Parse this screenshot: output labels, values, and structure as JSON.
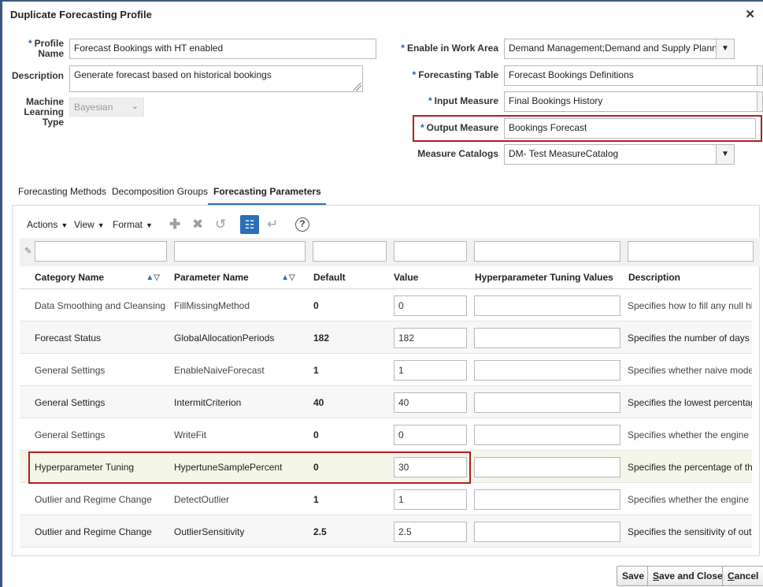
{
  "dialog": {
    "title": "Duplicate Forecasting Profile",
    "close_glyph": "✕"
  },
  "form": {
    "profile_name_label": "Profile Name",
    "profile_name_label_l1": "Profile",
    "profile_name_label_l2": "Name",
    "profile_name_value": "Forecast Bookings with HT enabled",
    "description_label": "Description",
    "description_value": "Generate forecast based on historical bookings",
    "ml_type_label_l1": "Machine",
    "ml_type_label_l2": "Learning",
    "ml_type_label_l3": "Type",
    "ml_type_value": "Bayesian",
    "work_area_label": "Enable in Work Area",
    "work_area_value": "Demand Management;Demand and Supply Planning",
    "forecasting_table_label": "Forecasting Table",
    "forecasting_table_value": "Forecast Bookings Definitions",
    "input_measure_label": "Input Measure",
    "input_measure_value": "Final Bookings History",
    "output_measure_label": "Output Measure",
    "output_measure_value": "Bookings Forecast",
    "measure_catalogs_label": "Measure Catalogs",
    "measure_catalogs_value": "DM- Test MeasureCatalog"
  },
  "tabs": [
    {
      "label": "Forecasting Methods",
      "active": false
    },
    {
      "label": "Decomposition Groups",
      "active": false
    },
    {
      "label": "Forecasting Parameters",
      "active": true
    }
  ],
  "toolbar": {
    "actions": "Actions",
    "view": "View",
    "format": "Format"
  },
  "table": {
    "headers": [
      "Category Name",
      "Parameter Name",
      "Default",
      "Value",
      "Hyperparameter Tuning Values",
      "Description"
    ],
    "rows": [
      {
        "category": "Data Smoothing and Cleansing",
        "parameter": "FillMissingMethod",
        "default": "0",
        "value": "0",
        "hyper": "",
        "description": "Specifies how to fill any null histo"
      },
      {
        "category": "Forecast Status",
        "parameter": "GlobalAllocationPeriods",
        "default": "182",
        "value": "182",
        "hyper": "",
        "description": "Specifies the number of days to"
      },
      {
        "category": "General Settings",
        "parameter": "EnableNaiveForecast",
        "default": "1",
        "value": "1",
        "hyper": "",
        "description": "Specifies whether naive modelin"
      },
      {
        "category": "General Settings",
        "parameter": "IntermitCriterion",
        "default": "40",
        "value": "40",
        "hyper": "",
        "description": "Specifies the lowest percentage"
      },
      {
        "category": "General Settings",
        "parameter": "WriteFit",
        "default": "0",
        "value": "0",
        "hyper": "",
        "description": "Specifies whether the engine on"
      },
      {
        "category": "Hyperparameter Tuning",
        "parameter": "HypertuneSamplePercent",
        "default": "0",
        "value": "30",
        "hyper": "",
        "description": "Specifies the percentage of the p"
      },
      {
        "category": "Outlier and Regime Change",
        "parameter": "DetectOutlier",
        "default": "1",
        "value": "1",
        "hyper": "",
        "description": "Specifies whether the engine sh"
      },
      {
        "category": "Outlier and Regime Change",
        "parameter": "OutlierSensitivity",
        "default": "2.5",
        "value": "2.5",
        "hyper": "",
        "description": "Specifies the sensitivity of outlie"
      }
    ]
  },
  "buttons": {
    "save": "Save",
    "save_close_u": "S",
    "save_close_rest": "ave and Close",
    "cancel_u": "C",
    "cancel_rest": "ancel"
  },
  "colors": {
    "accent": "#2c6fb7",
    "highlight": "#b01e23"
  }
}
